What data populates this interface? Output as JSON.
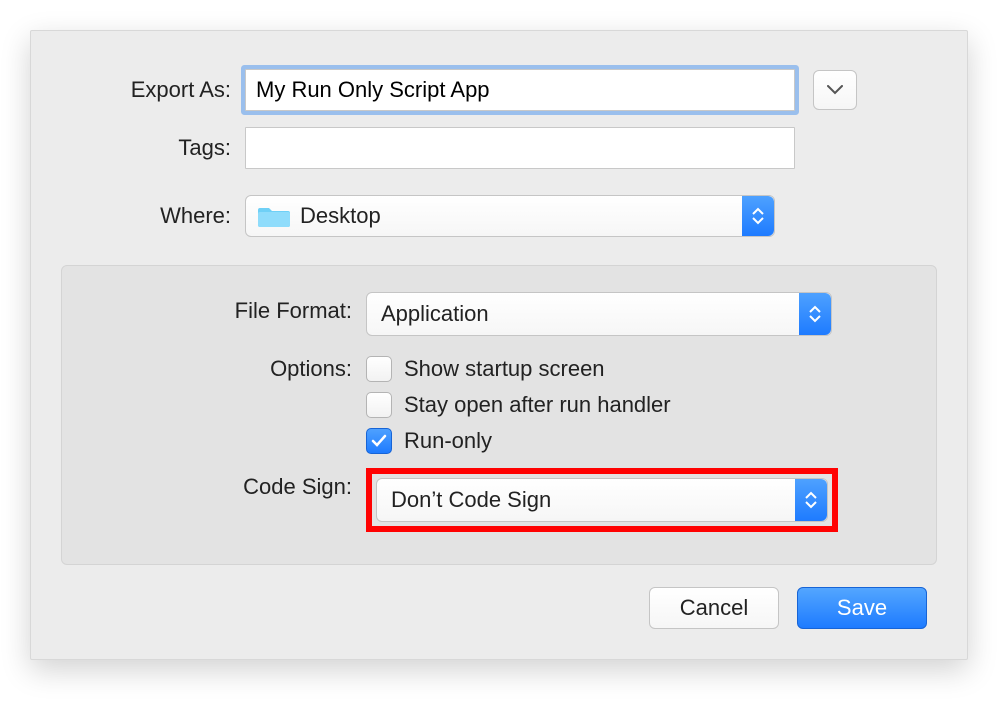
{
  "labels": {
    "export_as": "Export As:",
    "tags": "Tags:",
    "where": "Where:",
    "file_format": "File Format:",
    "options": "Options:",
    "code_sign": "Code Sign:"
  },
  "export_as": {
    "value": "My Run Only Script App"
  },
  "tags": {
    "value": ""
  },
  "where": {
    "selected": "Desktop"
  },
  "file_format": {
    "selected": "Application"
  },
  "options_checkboxes": {
    "show_startup": {
      "label": "Show startup screen",
      "checked": false
    },
    "stay_open": {
      "label": "Stay open after run handler",
      "checked": false
    },
    "run_only": {
      "label": "Run-only",
      "checked": true
    }
  },
  "code_sign": {
    "selected": "Don’t Code Sign"
  },
  "buttons": {
    "cancel": "Cancel",
    "save": "Save"
  }
}
